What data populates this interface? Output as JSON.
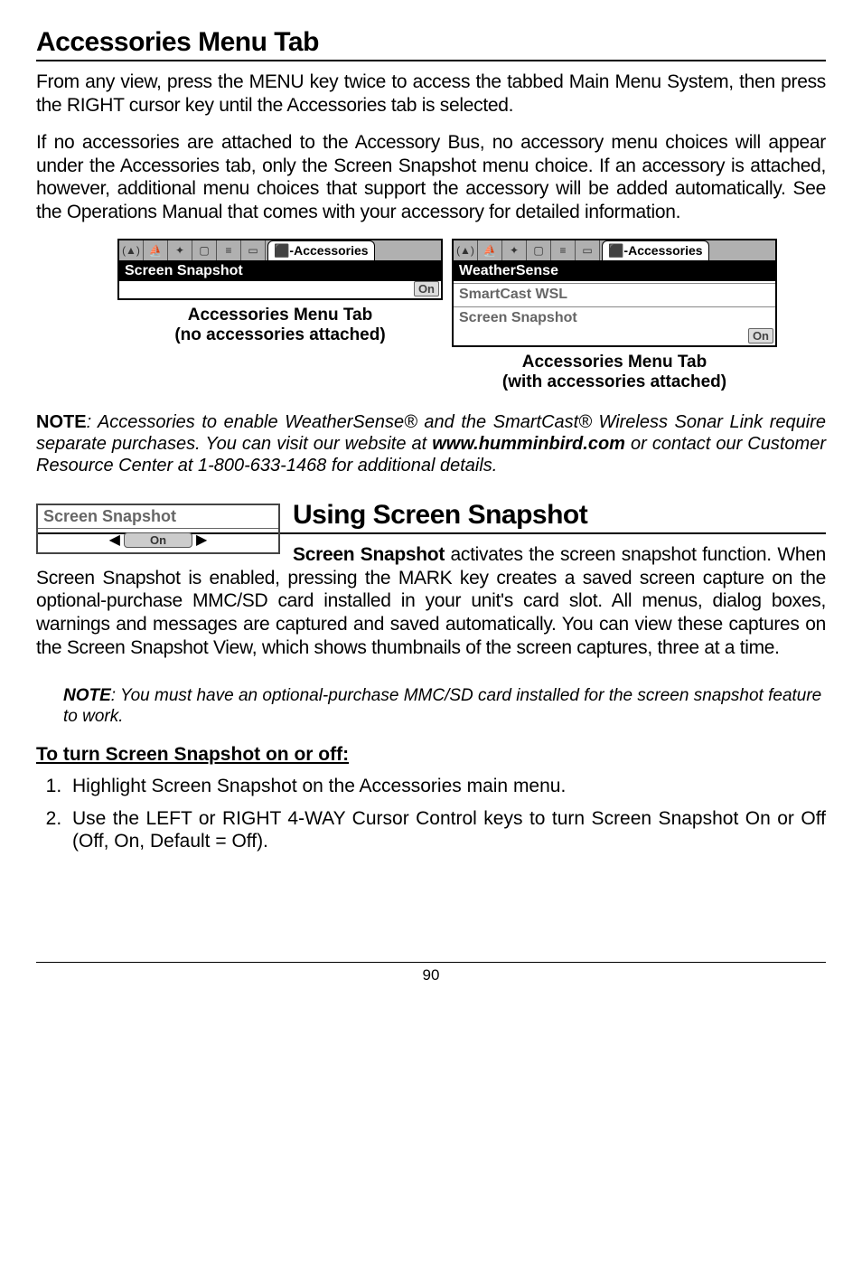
{
  "title1": "Accessories Menu Tab",
  "para1": "From any view, press the MENU key twice to access the tabbed Main Menu System, then press the RIGHT cursor key until the Accessories tab is selected.",
  "para2": "If no accessories are attached to the Accessory Bus, no accessory menu choices will appear under the Accessories tab, only the Screen Snapshot menu choice.  If an accessory is attached, however, additional menu choices that support the accessory will be added automatically.  See the Operations Manual that comes with your accessory for detailed information.",
  "fig1": {
    "tab_label": "Accessories",
    "item": "Screen Snapshot",
    "value": "On",
    "caption1": "Accessories Menu Tab",
    "caption2": "(no accessories attached)"
  },
  "fig2": {
    "tab_label": "Accessories",
    "item1": "WeatherSense",
    "item2": "SmartCast WSL",
    "item3": "Screen Snapshot",
    "value": "On",
    "caption1": "Accessories Menu Tab",
    "caption2": "(with accessories attached)"
  },
  "note1_lead": "NOTE",
  "note1_body_a": ": Accessories to enable WeatherSense® and the SmartCast® Wireless Sonar Link require separate purchases.  You can visit our website at ",
  "note1_url": "www.humminbird.com",
  "note1_body_b": " or contact our Customer Resource Center at 1-800-633-1468 for additional details.",
  "title2": "Using Screen Snapshot",
  "snapshot_fig": {
    "label": "Screen Snapshot",
    "value": "On"
  },
  "para3_lead": "Screen Snapshot",
  "para3_rest": " activates the screen snapshot function. When Screen Snapshot is enabled, pressing the MARK key creates a saved screen capture on the optional-purchase MMC/SD card installed in your unit's card slot. All menus, dialog boxes, warnings and messages are captured and saved automatically. You can view these captures on the Screen Snapshot View, which shows thumbnails of the screen captures, three at a time.",
  "note2_lead": "NOTE",
  "note2_body": ": You must have an optional-purchase MMC/SD card installed for the screen snapshot feature to work.",
  "steps_head": "To turn Screen Snapshot on or off:",
  "step1": "Highlight Screen Snapshot on the Accessories main menu.",
  "step2": "Use the LEFT or RIGHT 4-WAY Cursor Control keys to turn Screen Snapshot On or Off (Off, On, Default = Off).",
  "page_no": "90"
}
